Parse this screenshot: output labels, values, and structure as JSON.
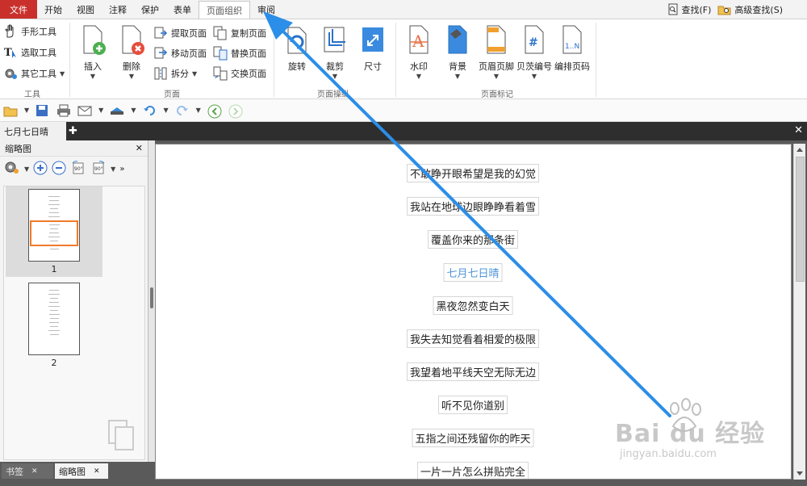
{
  "menubar": {
    "file": "文件",
    "items": [
      "开始",
      "视图",
      "注释",
      "保护",
      "表单",
      "页面组织",
      "审阅"
    ],
    "active_index": 5,
    "find": "查找(F)",
    "advanced_find": "高级查找(S)"
  },
  "ribbon": {
    "tools": {
      "hand": "手形工具",
      "select": "选取工具",
      "other": "其它工具",
      "group_label": "工具"
    },
    "pages": {
      "insert": "插入",
      "delete": "删除",
      "extract": "提取页面",
      "move": "移动页面",
      "split": "拆分",
      "copy": "复制页面",
      "replace": "替换页面",
      "swap": "交换页面",
      "group_label": "页面"
    },
    "page_ops": {
      "rotate": "旋转",
      "crop": "裁剪",
      "size": "尺寸",
      "group_label": "页面操纵"
    },
    "page_marks": {
      "watermark": "水印",
      "background": "背景",
      "header_footer": "页眉页脚",
      "bates": "贝茨编号",
      "page_number": "编排页码",
      "group_label": "页面标记"
    }
  },
  "doc_tab": {
    "title": "七月七日晴"
  },
  "left_panel": {
    "title": "缩略图",
    "thumbnails": [
      {
        "number": "1"
      },
      {
        "number": "2"
      }
    ],
    "bottom_tabs": [
      "书签",
      "缩略图"
    ]
  },
  "document": {
    "lines": [
      "不敢睁开眼希望是我的幻觉",
      "我站在地球边眼睁睁看着雪",
      "覆盖你来的那条街",
      "七月七日晴",
      "黑夜忽然变白天",
      "我失去知觉看着相爱的极限",
      "我望着地平线天空无际无边",
      "听不见你道别",
      "五指之间还残留你的昨天",
      "一片一片怎么拼贴完全"
    ],
    "highlight_index": 3
  },
  "watermark": {
    "brand": "Bai du 经验",
    "url": "jingyan.baidu.com"
  },
  "colors": {
    "file_menu": "#c9302c",
    "arrow": "#2b8ee8",
    "highlight_text": "#4f94d8"
  }
}
